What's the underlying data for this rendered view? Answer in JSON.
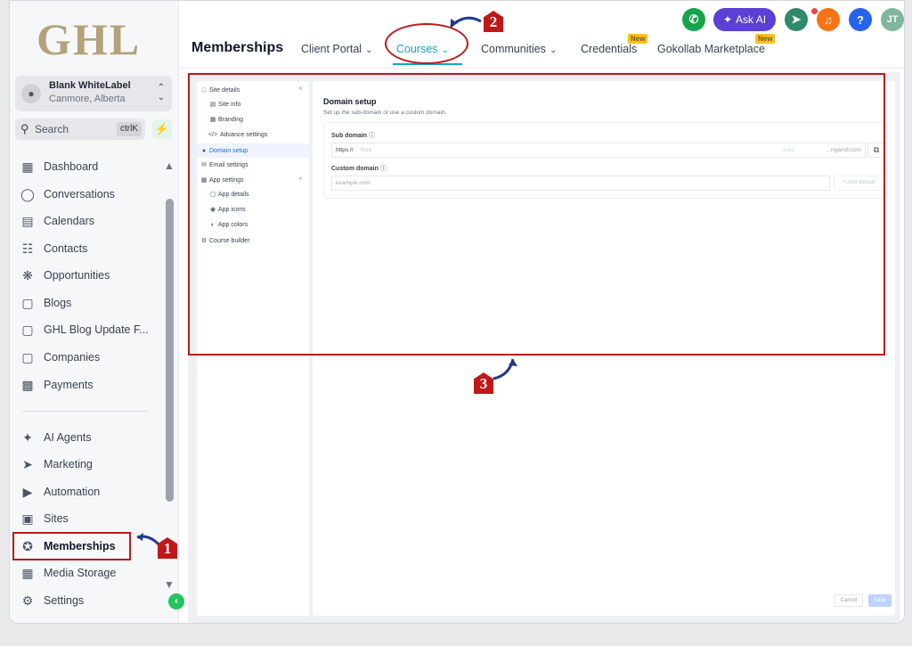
{
  "app": {
    "logo_text": "GHL"
  },
  "account": {
    "name": "Blank WhiteLabel",
    "location": "Canmore, Alberta"
  },
  "search": {
    "label": "Search",
    "shortcut": "ctrlK"
  },
  "sidebar": {
    "items": [
      {
        "label": "Dashboard",
        "icon": "dashboard-icon"
      },
      {
        "label": "Conversations",
        "icon": "chat-icon"
      },
      {
        "label": "Calendars",
        "icon": "calendar-icon"
      },
      {
        "label": "Contacts",
        "icon": "contacts-icon"
      },
      {
        "label": "Opportunities",
        "icon": "opportunities-icon"
      },
      {
        "label": "Blogs",
        "icon": "blog-icon"
      },
      {
        "label": "GHL Blog Update F...",
        "icon": "blog-icon"
      },
      {
        "label": "Companies",
        "icon": "companies-icon"
      },
      {
        "label": "Payments",
        "icon": "payments-icon"
      },
      {
        "label": "AI Agents",
        "icon": "sparkle-icon"
      },
      {
        "label": "Marketing",
        "icon": "send-icon"
      },
      {
        "label": "Automation",
        "icon": "automation-icon"
      },
      {
        "label": "Sites",
        "icon": "sites-icon"
      },
      {
        "label": "Memberships",
        "icon": "award-icon"
      },
      {
        "label": "Media Storage",
        "icon": "image-icon"
      },
      {
        "label": "Settings",
        "icon": "gear-icon"
      }
    ]
  },
  "header": {
    "title": "Memberships",
    "tabs": [
      {
        "label": "Client Portal",
        "dropdown": true
      },
      {
        "label": "Courses",
        "dropdown": true,
        "active": true
      },
      {
        "label": "Communities",
        "dropdown": true
      },
      {
        "label": "Credentials",
        "badge": "New"
      },
      {
        "label": "Gokollab Marketplace",
        "badge": "New"
      }
    ],
    "ask_ai": "Ask AI",
    "user_initials": "JT",
    "help": "?"
  },
  "settings_nav": {
    "items": [
      {
        "label": "Site details",
        "icon": "monitor-icon",
        "level": 0,
        "caret": "^"
      },
      {
        "label": "Site info",
        "icon": "info-icon",
        "level": 1
      },
      {
        "label": "Branding",
        "icon": "branding-icon",
        "level": 1
      },
      {
        "label": "Advance settings",
        "icon": "code-icon",
        "level": 1
      },
      {
        "label": "Domain setup",
        "icon": "globe-icon",
        "level": 0,
        "active": true
      },
      {
        "label": "Email settings",
        "icon": "mail-icon",
        "level": 0
      },
      {
        "label": "App settings",
        "icon": "app-icon",
        "level": 0,
        "caret": "^"
      },
      {
        "label": "App details",
        "icon": "app-icon",
        "level": 1
      },
      {
        "label": "App icons",
        "icon": "icons-icon",
        "level": 1
      },
      {
        "label": "App colors",
        "icon": "palette-icon",
        "level": 1
      },
      {
        "label": "Course builder",
        "icon": "gear-icon",
        "level": 0
      }
    ]
  },
  "domain_setup": {
    "title": "Domain setup",
    "subtitle": "Set up the sub-domain or use a custom domain.",
    "sub_domain_label": "Sub domain",
    "sub_prefix": "https://",
    "sub_value": "Rea",
    "sub_mid": "Joes",
    "sub_suffix": "...ngandt.com",
    "custom_domain_label": "Custom domain",
    "custom_placeholder": "example.com",
    "add_domain": "+ Add domain",
    "cancel": "Cancel",
    "save": "Save"
  },
  "annotations": {
    "step1": "1",
    "step2": "2",
    "step3": "3",
    "color": "#b91c1c"
  }
}
